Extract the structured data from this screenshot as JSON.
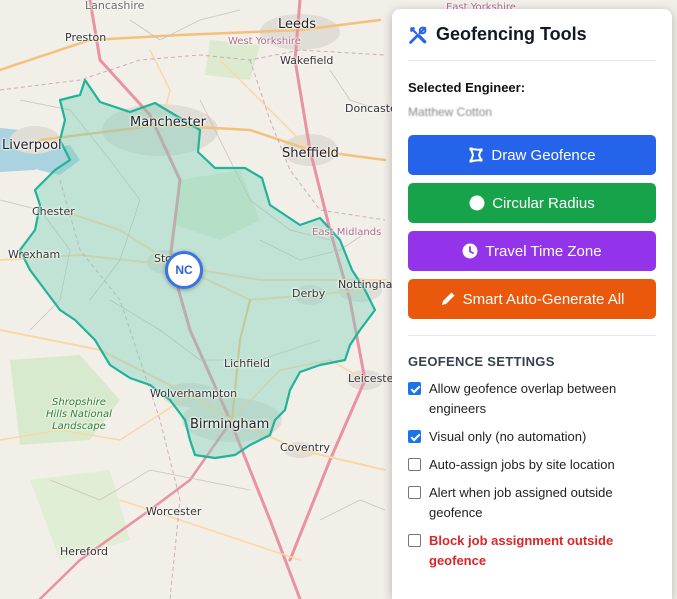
{
  "map": {
    "marker_label": "NC",
    "cities": [
      {
        "id": "lancashire",
        "label": "Lancashire"
      },
      {
        "id": "east-yorkshire",
        "label": "East Yorkshire"
      },
      {
        "id": "preston",
        "label": "Preston"
      },
      {
        "id": "leeds",
        "label": "Leeds"
      },
      {
        "id": "west-yorkshire",
        "label": "West Yorkshire"
      },
      {
        "id": "wakefield",
        "label": "Wakefield"
      },
      {
        "id": "doncaster",
        "label": "Doncaster"
      },
      {
        "id": "manchester",
        "label": "Manchester"
      },
      {
        "id": "liverpool",
        "label": "Liverpool"
      },
      {
        "id": "sheffield",
        "label": "Sheffield"
      },
      {
        "id": "chester",
        "label": "Chester"
      },
      {
        "id": "east-midlands",
        "label": "East Midlands"
      },
      {
        "id": "wrexham",
        "label": "Wrexham"
      },
      {
        "id": "stoke",
        "label": "Sto"
      },
      {
        "id": "nottingham",
        "label": "Nottingham"
      },
      {
        "id": "derby",
        "label": "Derby"
      },
      {
        "id": "lichfield",
        "label": "Lichfield"
      },
      {
        "id": "leicester",
        "label": "Leicester"
      },
      {
        "id": "wolverhampton",
        "label": "Wolverhampton"
      },
      {
        "id": "birmingham",
        "label": "Birmingham"
      },
      {
        "id": "coventry",
        "label": "Coventry"
      },
      {
        "id": "worcester",
        "label": "Worcester"
      },
      {
        "id": "hereford",
        "label": "Hereford"
      }
    ],
    "park_lines": [
      "Shropshire",
      "Hills National",
      "Landscape"
    ]
  },
  "panel": {
    "title": "Geofencing Tools",
    "selected_label": "Selected Engineer:",
    "engineer_name": "Matthew Cotton",
    "buttons": {
      "draw": "Draw Geofence",
      "circle": "Circular Radius",
      "travel": "Travel Time Zone",
      "smart": "Smart Auto-Generate All"
    },
    "settings_title": "GEOFENCE SETTINGS",
    "settings": [
      {
        "label": "Allow geofence overlap between engineers",
        "checked": true
      },
      {
        "label": "Visual only (no automation)",
        "checked": true
      },
      {
        "label": "Auto-assign jobs by site location",
        "checked": false
      },
      {
        "label": "Alert when job assigned outside geofence",
        "checked": false
      },
      {
        "label": "Block job assignment outside geofence",
        "checked": false
      }
    ]
  },
  "colors": {
    "geofence_fill": "#7fd1b9",
    "geofence_stroke": "#1fb39a",
    "draw": "#2563eb",
    "circle": "#16a34a",
    "travel": "#9333ea",
    "smart": "#ea580c",
    "danger": "#dc2626"
  },
  "icons": {
    "header": "tools-icon",
    "draw": "polygon-icon",
    "circle": "circle-icon",
    "travel": "clock-icon",
    "smart": "pencil-icon"
  }
}
